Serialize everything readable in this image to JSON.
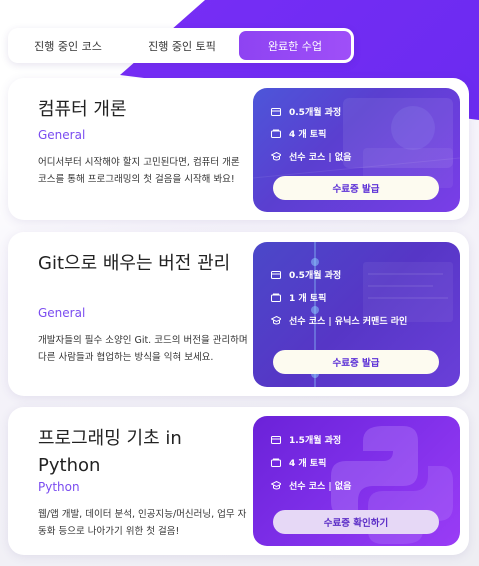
{
  "tabs": [
    {
      "label": "진행 중인 코스",
      "active": false
    },
    {
      "label": "진행 중인 토픽",
      "active": false
    },
    {
      "label": "완료한 수업",
      "active": true
    }
  ],
  "colors": {
    "accent": "#8e43f2",
    "category": "#7a4cf0"
  },
  "courses": [
    {
      "title": "컴퓨터 개론",
      "category": "General",
      "description": "어디서부터 시작해야 할지 고민된다면, 컴퓨터 개론 코스를 통해 프로그래밍의 첫 걸음을 시작해 봐요!",
      "duration": "0.5개월 과정",
      "topics": "4 개 토픽",
      "prereq": "선수 코스 | 없음",
      "button": "수료증 발급"
    },
    {
      "title": "Git으로 배우는 버전 관리",
      "category": "General",
      "description": "개발자들의 필수 소양인 Git. 코드의 버전을 관리하며 다른 사람들과 협업하는 방식을 익혀 보세요.",
      "duration": "0.5개월 과정",
      "topics": "1 개 토픽",
      "prereq": "선수 코스 | 유닉스 커맨드 라인",
      "button": "수료증 발급"
    },
    {
      "title": "프로그래밍 기초 in Python",
      "category": "Python",
      "description": "웹/앱 개발, 데이터 분석, 인공지능/머신러닝, 업무 자동화 등으로 나아가기 위한 첫 걸음!",
      "duration": "1.5개월 과정",
      "topics": "4 개 토픽",
      "prereq": "선수 코스 | 없음",
      "button": "수료증 확인하기"
    }
  ]
}
